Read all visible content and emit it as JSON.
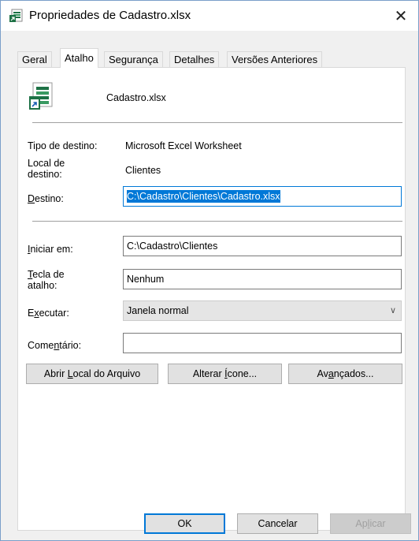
{
  "window": {
    "title": "Propriedades de Cadastro.xlsx",
    "close_glyph": "✕"
  },
  "tabs": [
    {
      "label": "Geral",
      "active": false
    },
    {
      "label": "Atalho",
      "active": true
    },
    {
      "label": "Segurança",
      "active": false
    },
    {
      "label": "Detalhes",
      "active": false
    },
    {
      "label": "Versões Anteriores",
      "active": false
    }
  ],
  "shortcut": {
    "file_name": "Cadastro.xlsx",
    "target_type_label": "Tipo de destino:",
    "target_type_value": "Microsoft Excel Worksheet",
    "target_location_label_line1": "Local de",
    "target_location_label_line2": "destino:",
    "target_location_value": "Clientes",
    "target_label": "Destino:",
    "target_value": "C:\\Cadastro\\Clientes\\Cadastro.xlsx",
    "start_in_label": "Iniciar em:",
    "start_in_value": "C:\\Cadastro\\Clientes",
    "hotkey_label_line1": "Tecla de",
    "hotkey_label_line2": "atalho:",
    "hotkey_value": "Nenhum",
    "run_label": "Executar:",
    "run_value": "Janela normal",
    "comment_label": "Comentário:",
    "comment_value": ""
  },
  "buttons": {
    "open_location": "Abrir Local do Arquivo",
    "change_icon": "Alterar Ícone...",
    "advanced": "Avançados...",
    "ok": "OK",
    "cancel": "Cancelar",
    "apply": "Aplicar"
  },
  "colors": {
    "accent": "#0078d7",
    "excel_green": "#1d7145"
  }
}
